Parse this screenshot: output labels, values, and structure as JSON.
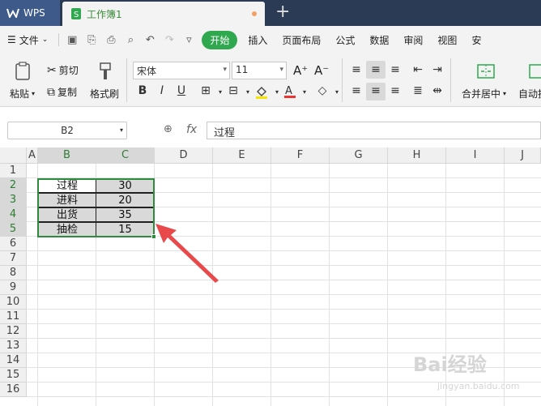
{
  "titlebar": {
    "app_label": "WPS",
    "doc_tab_label": "工作簿1",
    "new_tab_symbol": "+"
  },
  "menubar": {
    "file_label": "文件",
    "items": [
      "开始",
      "插入",
      "页面布局",
      "公式",
      "数据",
      "审阅",
      "视图",
      "安"
    ]
  },
  "ribbon": {
    "paste_label": "粘贴",
    "cut_label": "剪切",
    "copy_label": "复制",
    "format_painter_label": "格式刷",
    "font_name": "宋体",
    "font_size": "11",
    "grow_font": "A⁺",
    "shrink_font": "A⁻",
    "bold": "B",
    "italic": "I",
    "underline": "U",
    "merge_label": "合并居中",
    "autowrap_label": "自动换"
  },
  "formula_bar": {
    "cell_ref": "B2",
    "fx_label": "fx",
    "content": "过程"
  },
  "grid": {
    "columns": [
      "A",
      "B",
      "C",
      "D",
      "E",
      "F",
      "G",
      "H",
      "I",
      "J"
    ],
    "rows": [
      "1",
      "2",
      "3",
      "4",
      "5",
      "6",
      "7",
      "8",
      "9",
      "10",
      "11",
      "12",
      "13",
      "14",
      "15",
      "16"
    ],
    "data": [
      {
        "label": "过程",
        "value": "30"
      },
      {
        "label": "进料",
        "value": "20"
      },
      {
        "label": "出货",
        "value": "35"
      },
      {
        "label": "抽检",
        "value": "15"
      }
    ]
  },
  "colors": {
    "accent_green": "#2e8b3e",
    "titlebar_bg": "#2b3a55",
    "annotation_arrow": "#e8494b"
  },
  "watermark": {
    "text": "Bai经验",
    "sub": "jingyan.baidu.com"
  }
}
